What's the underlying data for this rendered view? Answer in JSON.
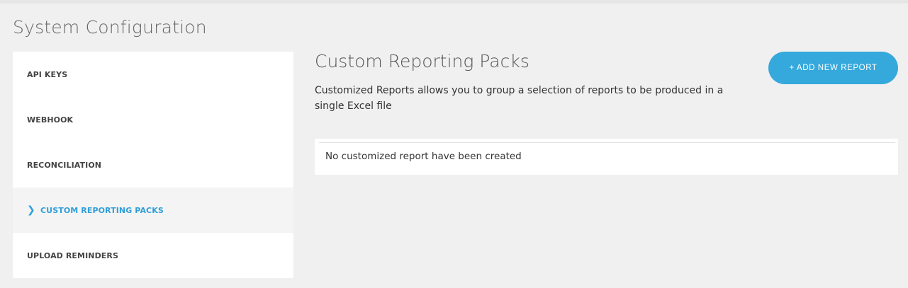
{
  "page": {
    "title": "System Configuration"
  },
  "sidebar": {
    "items": [
      {
        "label": "API KEYS",
        "active": false
      },
      {
        "label": "WEBHOOK",
        "active": false
      },
      {
        "label": "RECONCILIATION",
        "active": false
      },
      {
        "label": "CUSTOM REPORTING PACKS",
        "active": true
      },
      {
        "label": "UPLOAD REMINDERS",
        "active": false
      }
    ]
  },
  "main": {
    "title": "Custom Reporting Packs",
    "description": "Customized Reports allows you to group a selection of reports to be produced in a single Excel file",
    "add_button_label": "+ ADD NEW REPORT",
    "empty_message": "No customized report have been created"
  },
  "colors": {
    "accent": "#35a8dc",
    "active_text": "#2f9fd8",
    "background": "#f0f0f0",
    "panel": "#ffffff"
  },
  "icons": {
    "active_indicator": "chevron-right-icon"
  }
}
